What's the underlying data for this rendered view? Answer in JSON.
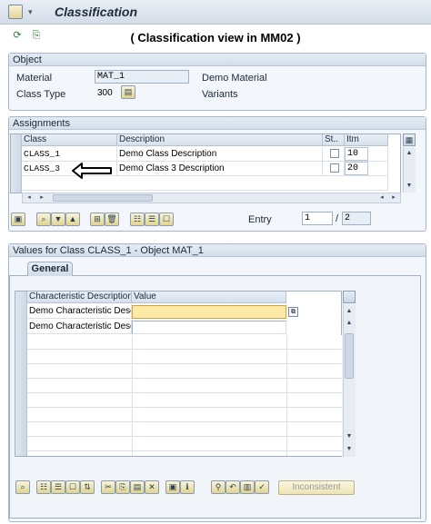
{
  "window": {
    "title": "Classification"
  },
  "view_title": "( Classification view in MM02 )",
  "object": {
    "header": "Object",
    "material_label": "Material",
    "material_value": "MAT_1",
    "material_desc": "Demo Material",
    "class_type_label": "Class Type",
    "class_type_value": "300",
    "class_type_desc": "Variants"
  },
  "assignments": {
    "header": "Assignments",
    "columns": [
      "Class",
      "Description",
      "St..",
      "Itm"
    ],
    "rows": [
      {
        "class": "CLASS_1",
        "description": "Demo Class Description",
        "itm": "10"
      },
      {
        "class": "CLASS_3",
        "description": "Demo Class 3 Description",
        "itm": "20"
      }
    ],
    "entry_label": "Entry",
    "entry_current": "1",
    "entry_total": "2"
  },
  "values": {
    "header": "Values for Class CLASS_1 - Object MAT_1",
    "tab_label": "General",
    "columns": [
      "Characteristic Description",
      "Value"
    ],
    "rows": [
      {
        "desc": "Demo Characteristic Desc..",
        "value": ""
      },
      {
        "desc": "Demo Characteristic Desc..",
        "value": ""
      }
    ],
    "inconsistent_label": "Inconsistent"
  }
}
